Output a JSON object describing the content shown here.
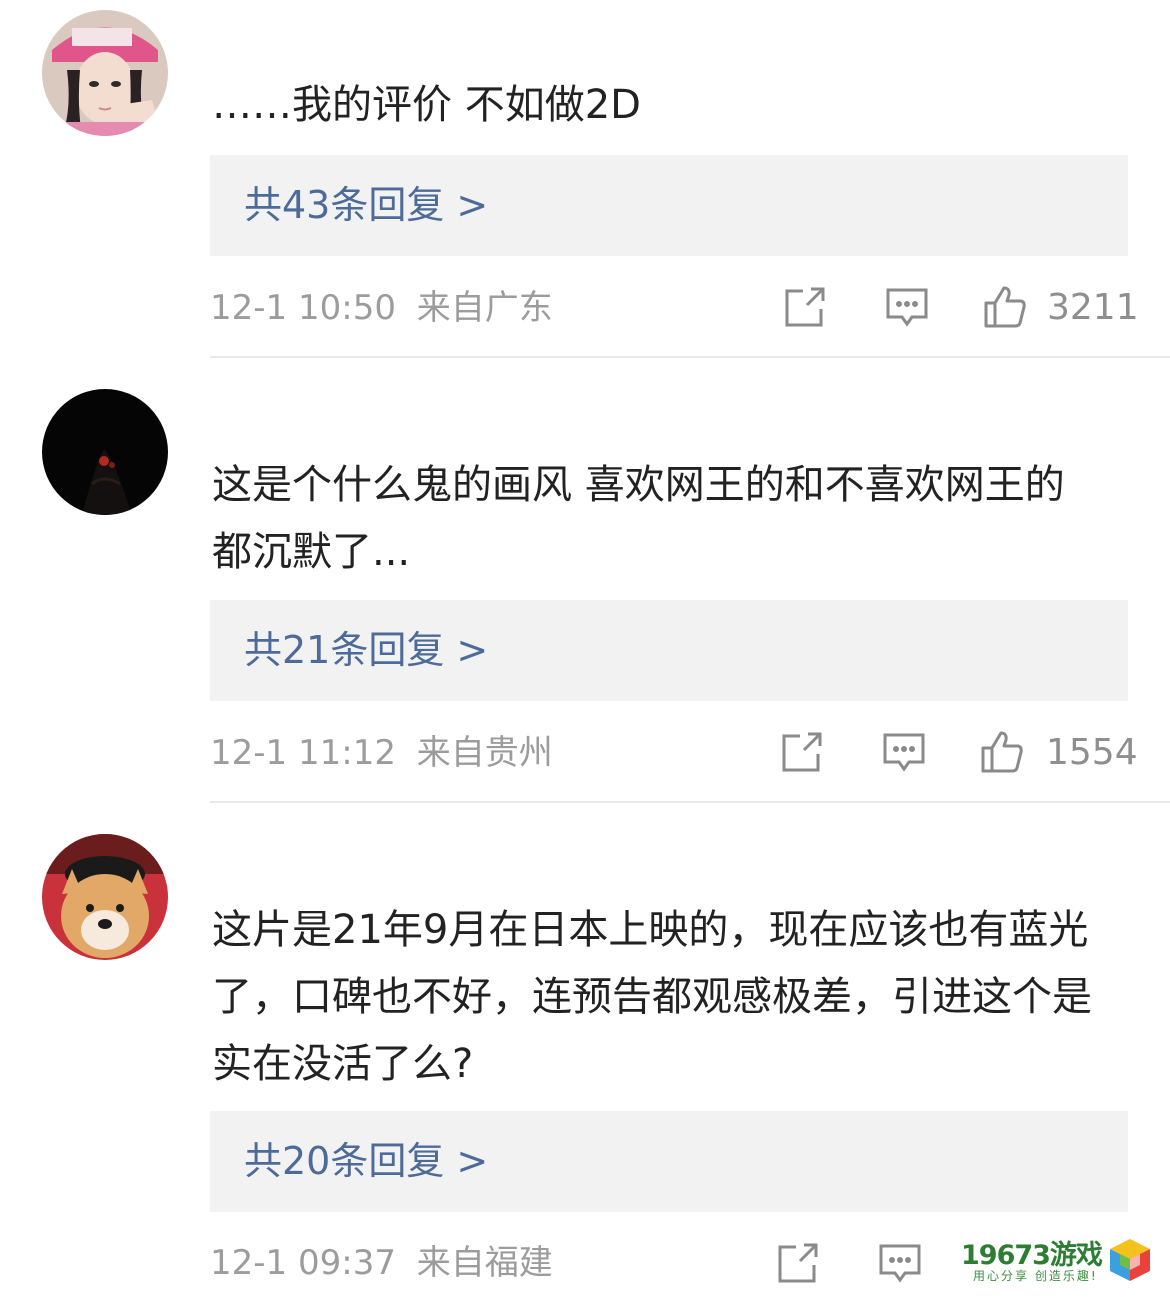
{
  "comments": [
    {
      "text": "……我的评价 不如做2D",
      "replies_label": "共43条回复 >",
      "timestamp": "12-1 10:50",
      "location": "来自广东",
      "likes": "3211",
      "avatar": "girl-pink-cap-avatar"
    },
    {
      "text": "这是个什么鬼的画风 喜欢网王的和不喜欢网王的都沉默了...",
      "replies_label": "共21条回复 >",
      "timestamp": "12-1 11:12",
      "location": "来自贵州",
      "likes": "1554",
      "avatar": "dark-night-avatar"
    },
    {
      "text": "这片是21年9月在日本上映的，现在应该也有蓝光了，口碑也不好，连预告都观感极差，引进这个是实在没活了么?",
      "replies_label": "共20条回复 >",
      "timestamp": "12-1 09:37",
      "location": "来自福建",
      "avatar": "shiba-dog-avatar"
    }
  ],
  "watermark": {
    "number": "19673游戏",
    "slogan": "用心分享 创造乐趣!"
  },
  "colors": {
    "reply_link": "#4d6b98",
    "meta_text": "#9c9c9c",
    "reply_box_bg": "#f2f2f2",
    "body_text": "#222222"
  }
}
